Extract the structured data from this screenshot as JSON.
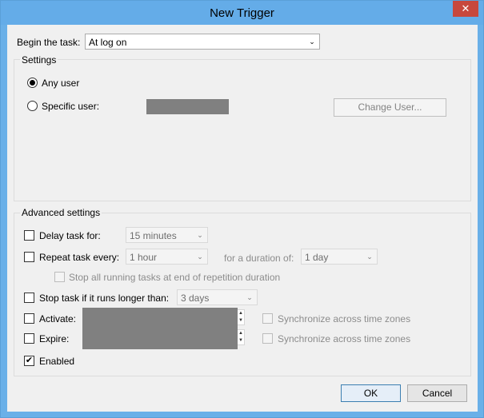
{
  "window": {
    "title": "New Trigger",
    "close_glyph": "✕"
  },
  "begin": {
    "label": "Begin the task:",
    "value": "At log on"
  },
  "settings": {
    "legend": "Settings",
    "any_user": "Any user",
    "specific_user": "Specific user:",
    "change_user": "Change User..."
  },
  "advanced": {
    "legend": "Advanced settings",
    "delay": {
      "label": "Delay task for:",
      "value": "15 minutes"
    },
    "repeat": {
      "label": "Repeat task every:",
      "value": "1 hour",
      "duration_label": "for a duration of:",
      "duration_value": "1 day"
    },
    "stop_all": "Stop all running tasks at end of repetition duration",
    "stop_longer": {
      "label": "Stop task if it runs longer than:",
      "value": "3 days"
    },
    "activate": {
      "label": "Activate:",
      "sync": "Synchronize across time zones"
    },
    "expire": {
      "label": "Expire:",
      "sync": "Synchronize across time zones"
    },
    "enabled": {
      "label": "Enabled",
      "check_glyph": "✔"
    }
  },
  "buttons": {
    "ok": "OK",
    "cancel": "Cancel"
  },
  "icons": {
    "chevron": "⌄",
    "spin_up": "▲",
    "spin_down": "▼"
  }
}
